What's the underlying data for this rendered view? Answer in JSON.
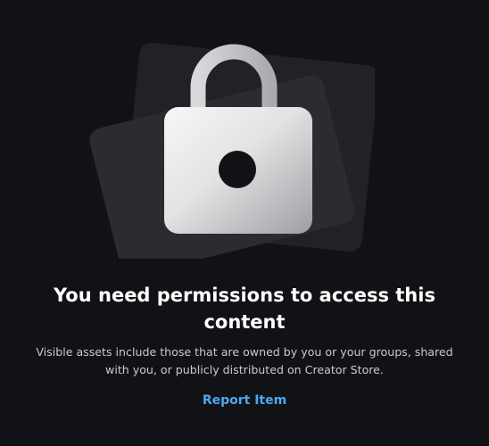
{
  "locked_state": {
    "illustration_icon": "lock-icon",
    "title": "You need permissions to access this content",
    "description": "Visible assets include those that are owned by you or your groups, shared with you, or publicly distributed on Creator Store.",
    "report_label": "Report Item"
  },
  "colors": {
    "background": "#111215",
    "card_dark": "#24262b",
    "card_mid": "#2c2e33",
    "lock_body_light": "#f7f7f7",
    "lock_body_dark": "#9d9fa3",
    "lock_shackle": "#c8c9cb",
    "keyhole": "#111215",
    "title_text": "#ffffff",
    "body_text": "#c9cbd1",
    "link": "#4fa7ee"
  }
}
